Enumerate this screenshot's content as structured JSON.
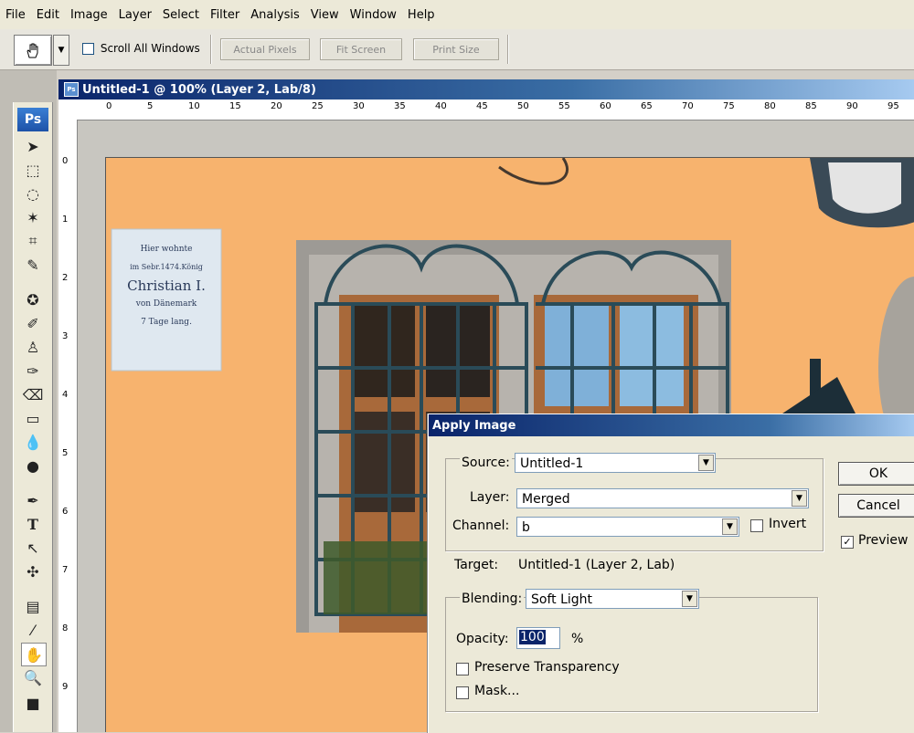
{
  "menu": [
    "File",
    "Edit",
    "Image",
    "Layer",
    "Select",
    "Filter",
    "Analysis",
    "View",
    "Window",
    "Help"
  ],
  "options": {
    "scroll_all": "Scroll All Windows",
    "actual_pixels": "Actual Pixels",
    "fit_screen": "Fit Screen",
    "print_size": "Print Size"
  },
  "toolbox": {
    "logo": "Ps"
  },
  "document": {
    "title": "Untitled-1 @ 100% (Layer 2, Lab/8)",
    "ruler_h": [
      "0",
      "5",
      "10",
      "15",
      "20",
      "25",
      "30",
      "35",
      "40",
      "45",
      "50",
      "55",
      "60",
      "65",
      "70",
      "75",
      "80",
      "85",
      "90",
      "95"
    ],
    "ruler_v": [
      "0",
      "1",
      "2",
      "3",
      "4",
      "5",
      "6",
      "7",
      "8",
      "9"
    ],
    "plaque": [
      "Hier wohnte",
      "im Sebr.1474.König",
      "Christian I.",
      "von Dänemark",
      "7 Tage lang."
    ]
  },
  "dialog": {
    "title": "Apply Image",
    "source_label": "Source:",
    "source_value": "Untitled-1",
    "layer_label": "Layer:",
    "layer_value": "Merged",
    "channel_label": "Channel:",
    "channel_value": "b",
    "invert_label": "Invert",
    "target_label": "Target:",
    "target_value": "Untitled-1 (Layer 2, Lab)",
    "blending_label": "Blending:",
    "blending_value": "Soft Light",
    "opacity_label": "Opacity:",
    "opacity_value": "100",
    "opacity_unit": "%",
    "preserve_label": "Preserve Transparency",
    "mask_label": "Mask...",
    "ok_label": "OK",
    "cancel_label": "Cancel",
    "preview_label": "Preview",
    "preview_checked": "✓"
  }
}
